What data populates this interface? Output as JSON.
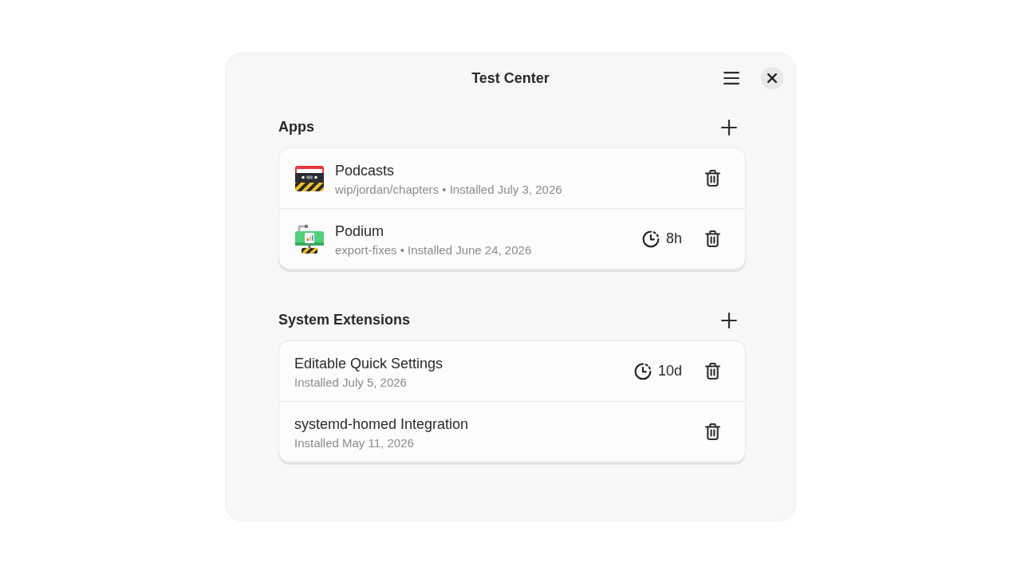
{
  "window": {
    "title": "Test Center"
  },
  "sections": [
    {
      "heading": "Apps",
      "items": [
        {
          "kind": "app",
          "name": "Podcasts",
          "subtitle": "wip/jordan/chapters • Installed July 3, 2026"
        },
        {
          "kind": "app",
          "name": "Podium",
          "subtitle": "export-fixes • Installed June 24, 2026",
          "expires": "8h"
        }
      ]
    },
    {
      "heading": "System Extensions",
      "items": [
        {
          "kind": "extension",
          "name": "Editable Quick Settings",
          "subtitle": "Installed July 5, 2026",
          "expires": "10d"
        },
        {
          "kind": "extension",
          "name": "systemd-homed Integration",
          "subtitle": "Installed May 11, 2026"
        }
      ]
    }
  ]
}
